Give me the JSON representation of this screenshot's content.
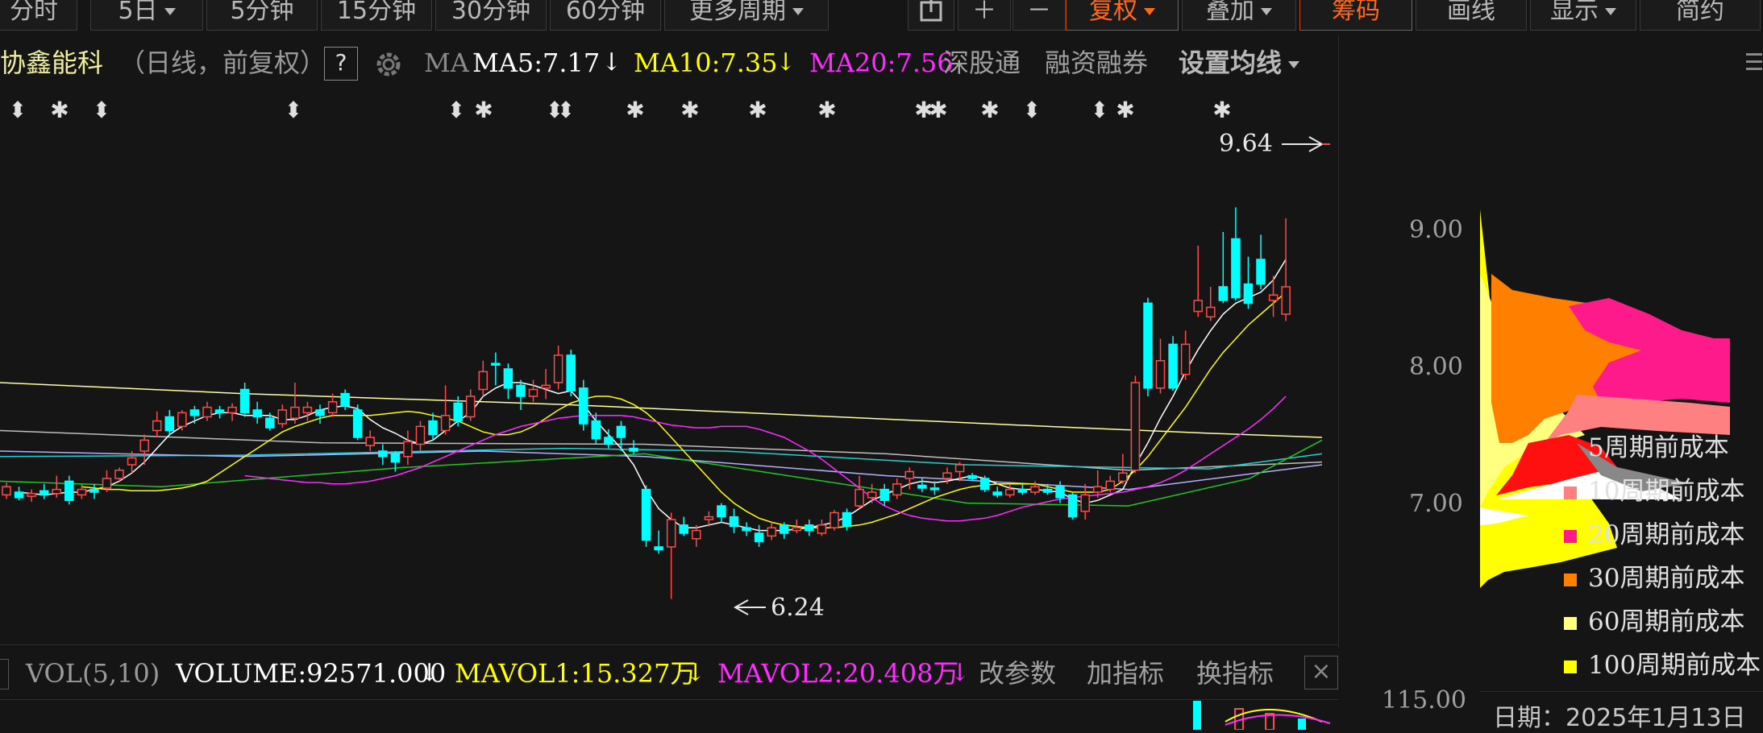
{
  "toolbar": {
    "left_buttons": [
      {
        "label": "分时",
        "caret": false,
        "active": false
      },
      {
        "label": "5日",
        "caret": true,
        "active": false
      },
      {
        "label": "5分钟",
        "caret": false,
        "active": false
      },
      {
        "label": "15分钟",
        "caret": false,
        "active": false
      },
      {
        "label": "30分钟",
        "caret": false,
        "active": false
      },
      {
        "label": "60分钟",
        "caret": false,
        "active": false
      },
      {
        "label": "更多周期",
        "caret": true,
        "active": false
      }
    ],
    "right_buttons": [
      {
        "label": "复权",
        "caret": true,
        "active": true
      },
      {
        "label": "叠加",
        "caret": true,
        "active": false
      },
      {
        "label": "筹码",
        "caret": false,
        "active": true
      },
      {
        "label": "画线",
        "caret": false,
        "active": false
      },
      {
        "label": "显示",
        "caret": true,
        "active": false
      },
      {
        "label": "简约",
        "caret": false,
        "active": false
      }
    ]
  },
  "header": {
    "stock_name": "协鑫能科",
    "period_info": "（日线，前复权）",
    "help": "?",
    "ma_label": "MA",
    "ma5": "MA5:7.17",
    "ma10": "MA10:7.35",
    "ma20": "MA20:7.56",
    "down_arrow": "↓",
    "link1": "深股通",
    "link2": "融资融券",
    "set_ma": "设置均线"
  },
  "colors": {
    "ma5": "#ffffff",
    "ma10": "#ffff00",
    "ma20": "#ff2bff",
    "up": "#ff4a4a",
    "down": "#00ffff",
    "accent": "#ff6a1a",
    "ma30": "#1ec81e",
    "ma60": "#b0b0ff",
    "ma120": "#20d0d0",
    "ma250": "#ffffa0"
  },
  "chart_data": {
    "type": "candlestick",
    "price_axis": {
      "ticks": [
        9.0,
        8.0,
        7.0
      ],
      "tick_labels": [
        "9.00",
        "8.00",
        "7.00"
      ],
      "range": [
        6.0,
        10.0
      ]
    },
    "high_marker": "9.64",
    "low_marker": "6.24",
    "volume_axis_label": "115.00",
    "candles": [
      [
        7.08,
        7.14,
        7.05,
        7.17
      ],
      [
        7.1,
        7.06,
        7.04,
        7.14
      ],
      [
        7.07,
        7.09,
        7.03,
        7.12
      ],
      [
        7.11,
        7.08,
        7.05,
        7.16
      ],
      [
        7.09,
        7.12,
        7.06,
        7.22
      ],
      [
        7.18,
        7.04,
        7.01,
        7.22
      ],
      [
        7.08,
        7.12,
        7.05,
        7.16
      ],
      [
        7.12,
        7.1,
        7.05,
        7.16
      ],
      [
        7.13,
        7.2,
        7.1,
        7.26
      ],
      [
        7.2,
        7.26,
        7.18,
        7.28
      ],
      [
        7.3,
        7.35,
        7.24,
        7.4
      ],
      [
        7.4,
        7.48,
        7.3,
        7.52
      ],
      [
        7.55,
        7.62,
        7.5,
        7.69
      ],
      [
        7.65,
        7.55,
        7.52,
        7.7
      ],
      [
        7.58,
        7.68,
        7.55,
        7.7
      ],
      [
        7.7,
        7.66,
        7.6,
        7.73
      ],
      [
        7.65,
        7.72,
        7.62,
        7.76
      ],
      [
        7.7,
        7.68,
        7.64,
        7.73
      ],
      [
        7.68,
        7.72,
        7.62,
        7.75
      ],
      [
        7.85,
        7.68,
        7.65,
        7.9
      ],
      [
        7.7,
        7.65,
        7.6,
        7.76
      ],
      [
        7.64,
        7.57,
        7.55,
        7.68
      ],
      [
        7.6,
        7.7,
        7.57,
        7.74
      ],
      [
        7.64,
        7.72,
        7.6,
        7.9
      ],
      [
        7.68,
        7.72,
        7.62,
        7.76
      ],
      [
        7.7,
        7.66,
        7.6,
        7.74
      ],
      [
        7.68,
        7.76,
        7.65,
        7.82
      ],
      [
        7.82,
        7.73,
        7.7,
        7.85
      ],
      [
        7.7,
        7.5,
        7.48,
        7.74
      ],
      [
        7.44,
        7.5,
        7.4,
        7.55
      ],
      [
        7.4,
        7.36,
        7.3,
        7.45
      ],
      [
        7.38,
        7.32,
        7.25,
        7.4
      ],
      [
        7.36,
        7.47,
        7.3,
        7.55
      ],
      [
        7.45,
        7.58,
        7.4,
        7.62
      ],
      [
        7.62,
        7.52,
        7.48,
        7.68
      ],
      [
        7.55,
        7.66,
        7.52,
        7.88
      ],
      [
        7.75,
        7.62,
        7.58,
        7.8
      ],
      [
        7.65,
        7.8,
        7.62,
        7.85
      ],
      [
        7.85,
        7.98,
        7.8,
        8.06
      ],
      [
        8.04,
        8.03,
        7.88,
        8.12
      ],
      [
        8.0,
        7.86,
        7.78,
        8.04
      ],
      [
        7.88,
        7.8,
        7.7,
        7.92
      ],
      [
        7.8,
        7.85,
        7.76,
        7.92
      ],
      [
        7.86,
        7.88,
        7.78,
        8.0
      ],
      [
        7.9,
        8.1,
        7.85,
        8.17
      ],
      [
        8.1,
        7.84,
        7.8,
        8.14
      ],
      [
        7.86,
        7.6,
        7.55,
        7.92
      ],
      [
        7.62,
        7.49,
        7.45,
        7.68
      ],
      [
        7.5,
        7.45,
        7.42,
        7.56
      ],
      [
        7.58,
        7.5,
        7.4,
        7.62
      ],
      [
        7.42,
        7.4,
        7.38,
        7.48
      ],
      [
        7.12,
        6.75,
        6.7,
        7.15
      ],
      [
        6.7,
        6.68,
        6.65,
        6.82
      ],
      [
        6.7,
        6.9,
        6.32,
        6.95
      ],
      [
        6.86,
        6.8,
        6.78,
        6.92
      ],
      [
        6.76,
        6.82,
        6.7,
        6.86
      ],
      [
        6.9,
        6.92,
        6.85,
        6.96
      ],
      [
        7.0,
        6.92,
        6.88,
        7.02
      ],
      [
        6.92,
        6.85,
        6.8,
        6.98
      ],
      [
        6.84,
        6.82,
        6.78,
        6.88
      ],
      [
        6.8,
        6.74,
        6.7,
        6.86
      ],
      [
        6.78,
        6.84,
        6.75,
        6.88
      ],
      [
        6.86,
        6.8,
        6.76,
        6.88
      ],
      [
        6.82,
        6.84,
        6.8,
        6.9
      ],
      [
        6.86,
        6.82,
        6.78,
        6.9
      ],
      [
        6.8,
        6.86,
        6.78,
        6.9
      ],
      [
        6.84,
        6.95,
        6.82,
        6.97
      ],
      [
        6.95,
        6.85,
        6.82,
        6.98
      ],
      [
        7.0,
        7.12,
        6.98,
        7.22
      ],
      [
        7.06,
        7.1,
        7.02,
        7.16
      ],
      [
        7.12,
        7.04,
        7.0,
        7.16
      ],
      [
        7.08,
        7.16,
        7.05,
        7.2
      ],
      [
        7.2,
        7.25,
        7.12,
        7.28
      ],
      [
        7.15,
        7.13,
        7.1,
        7.2
      ],
      [
        7.13,
        7.12,
        7.08,
        7.18
      ],
      [
        7.2,
        7.24,
        7.16,
        7.28
      ],
      [
        7.25,
        7.3,
        7.18,
        7.32
      ],
      [
        7.22,
        7.2,
        7.18,
        7.24
      ],
      [
        7.2,
        7.12,
        7.1,
        7.22
      ],
      [
        7.1,
        7.08,
        7.06,
        7.14
      ],
      [
        7.08,
        7.12,
        7.06,
        7.16
      ],
      [
        7.12,
        7.1,
        7.08,
        7.16
      ],
      [
        7.1,
        7.14,
        7.08,
        7.18
      ],
      [
        7.12,
        7.1,
        7.08,
        7.16
      ],
      [
        7.14,
        7.06,
        7.02,
        7.18
      ],
      [
        7.08,
        6.92,
        6.9,
        7.1
      ],
      [
        6.96,
        7.08,
        6.9,
        7.16
      ],
      [
        7.1,
        7.14,
        7.06,
        7.26
      ],
      [
        7.12,
        7.18,
        7.1,
        7.22
      ],
      [
        7.18,
        7.24,
        7.16,
        7.38
      ],
      [
        7.26,
        7.9,
        7.24,
        7.95
      ],
      [
        8.48,
        7.86,
        7.8,
        8.52
      ],
      [
        7.86,
        8.06,
        7.82,
        8.22
      ],
      [
        8.18,
        7.86,
        7.84,
        8.24
      ],
      [
        7.96,
        8.18,
        7.92,
        8.28
      ],
      [
        8.42,
        8.5,
        8.38,
        8.9
      ],
      [
        8.38,
        8.45,
        8.35,
        8.6
      ],
      [
        8.6,
        8.5,
        8.48,
        9.0
      ],
      [
        8.95,
        8.52,
        8.5,
        9.18
      ],
      [
        8.62,
        8.48,
        8.44,
        8.82
      ],
      [
        8.8,
        8.62,
        8.58,
        8.98
      ],
      [
        8.5,
        8.54,
        8.38,
        8.68
      ],
      [
        8.4,
        8.6,
        8.35,
        9.1
      ]
    ],
    "moving_averages": [
      {
        "name": "MA5",
        "values": [
          7.1,
          7.09,
          7.08,
          7.09,
          7.1,
          7.1,
          7.12,
          7.14,
          7.18,
          7.24,
          7.32,
          7.42,
          7.52,
          7.58,
          7.62,
          7.66,
          7.68,
          7.68,
          7.66,
          7.66,
          7.66,
          7.63,
          7.63,
          7.66,
          7.7,
          7.72,
          7.73,
          7.71,
          7.63,
          7.57,
          7.53,
          7.48,
          7.45,
          7.48,
          7.55,
          7.62,
          7.68,
          7.8,
          7.86,
          7.9,
          7.9,
          7.88,
          7.85,
          7.82,
          7.84,
          7.74,
          7.62,
          7.52,
          7.42,
          7.3,
          7.12,
          6.98,
          6.9,
          6.84,
          6.84,
          6.86,
          6.88,
          6.86,
          6.84,
          6.82,
          6.82,
          6.82,
          6.83,
          6.84,
          6.86,
          6.88,
          6.92,
          6.98,
          7.04,
          7.08,
          7.12,
          7.16,
          7.18,
          7.17,
          7.18,
          7.2,
          7.22,
          7.2,
          7.16,
          7.13,
          7.12,
          7.12,
          7.11,
          7.1,
          7.05,
          7.02,
          7.04,
          7.08,
          7.12,
          7.3,
          7.46,
          7.64,
          7.8,
          7.98,
          8.14,
          8.28,
          8.4,
          8.48,
          8.52,
          8.56,
          8.65,
          8.8
        ]
      },
      {
        "name": "MA10",
        "values": [
          7.14,
          7.13,
          7.12,
          7.12,
          7.11,
          7.11,
          7.11,
          7.12,
          7.13,
          7.15,
          7.18,
          7.24,
          7.3,
          7.36,
          7.42,
          7.48,
          7.54,
          7.58,
          7.61,
          7.64,
          7.66,
          7.66,
          7.66,
          7.66,
          7.67,
          7.68,
          7.69,
          7.68,
          7.66,
          7.64,
          7.62,
          7.58,
          7.54,
          7.52,
          7.52,
          7.54,
          7.58,
          7.64,
          7.7,
          7.75,
          7.78,
          7.8,
          7.8,
          7.78,
          7.74,
          7.68,
          7.6,
          7.5,
          7.4,
          7.3,
          7.2,
          7.1,
          7.02,
          6.96,
          6.91,
          6.88,
          6.86,
          6.85,
          6.84,
          6.84,
          6.84,
          6.85,
          6.86,
          6.88,
          6.91,
          6.94,
          6.98,
          7.02,
          7.06,
          7.09,
          7.12,
          7.14,
          7.15,
          7.16,
          7.16,
          7.16,
          7.16,
          7.14,
          7.12,
          7.1,
          7.1,
          7.1,
          7.12,
          7.18,
          7.26,
          7.36,
          7.48,
          7.6,
          7.72,
          7.86,
          8.0,
          8.12,
          8.22,
          8.32,
          8.4,
          8.48,
          8.56
        ]
      },
      {
        "name": "MA20",
        "values": [
          7.22,
          7.21,
          7.2,
          7.19,
          7.18,
          7.17,
          7.17,
          7.16,
          7.16,
          7.17,
          7.18,
          7.2,
          7.22,
          7.25,
          7.28,
          7.32,
          7.36,
          7.4,
          7.44,
          7.48,
          7.52,
          7.55,
          7.58,
          7.6,
          7.62,
          7.64,
          7.65,
          7.66,
          7.66,
          7.66,
          7.66,
          7.65,
          7.63,
          7.61,
          7.59,
          7.58,
          7.57,
          7.57,
          7.58,
          7.58,
          7.58,
          7.56,
          7.53,
          7.5,
          7.45,
          7.4,
          7.34,
          7.27,
          7.2,
          7.13,
          7.06,
          7.0,
          6.96,
          6.93,
          6.91,
          6.9,
          6.89,
          6.89,
          6.9,
          6.91,
          6.93,
          6.96,
          6.99,
          7.01,
          7.03,
          7.05,
          7.06,
          7.07,
          7.08,
          7.09,
          7.1,
          7.12,
          7.14,
          7.17,
          7.21,
          7.26,
          7.32,
          7.38,
          7.44,
          7.5,
          7.56,
          7.63,
          7.71,
          7.8
        ]
      }
    ]
  },
  "volume_bar": {
    "label": "VOL(5,10)",
    "volume": "VOLUME:92571.000",
    "mavol1": "MAVOL1:15.327万",
    "mavol2": "MAVOL2:20.408万",
    "arrow": "↓",
    "btn1": "改参数",
    "btn2": "加指标",
    "btn3": "换指标",
    "close": "×"
  },
  "chips": {
    "legend": [
      {
        "label": "5周期前成本",
        "color": "#ff1010"
      },
      {
        "label": "10周期前成本",
        "color": "#ff8080"
      },
      {
        "label": "20周期前成本",
        "color": "#ff1a8c"
      },
      {
        "label": "30周期前成本",
        "color": "#ff8000"
      },
      {
        "label": "60周期前成本",
        "color": "#ffff80"
      },
      {
        "label": "100周期前成本",
        "color": "#ffff00"
      }
    ],
    "date_label": "日期：2025年1月13日"
  }
}
